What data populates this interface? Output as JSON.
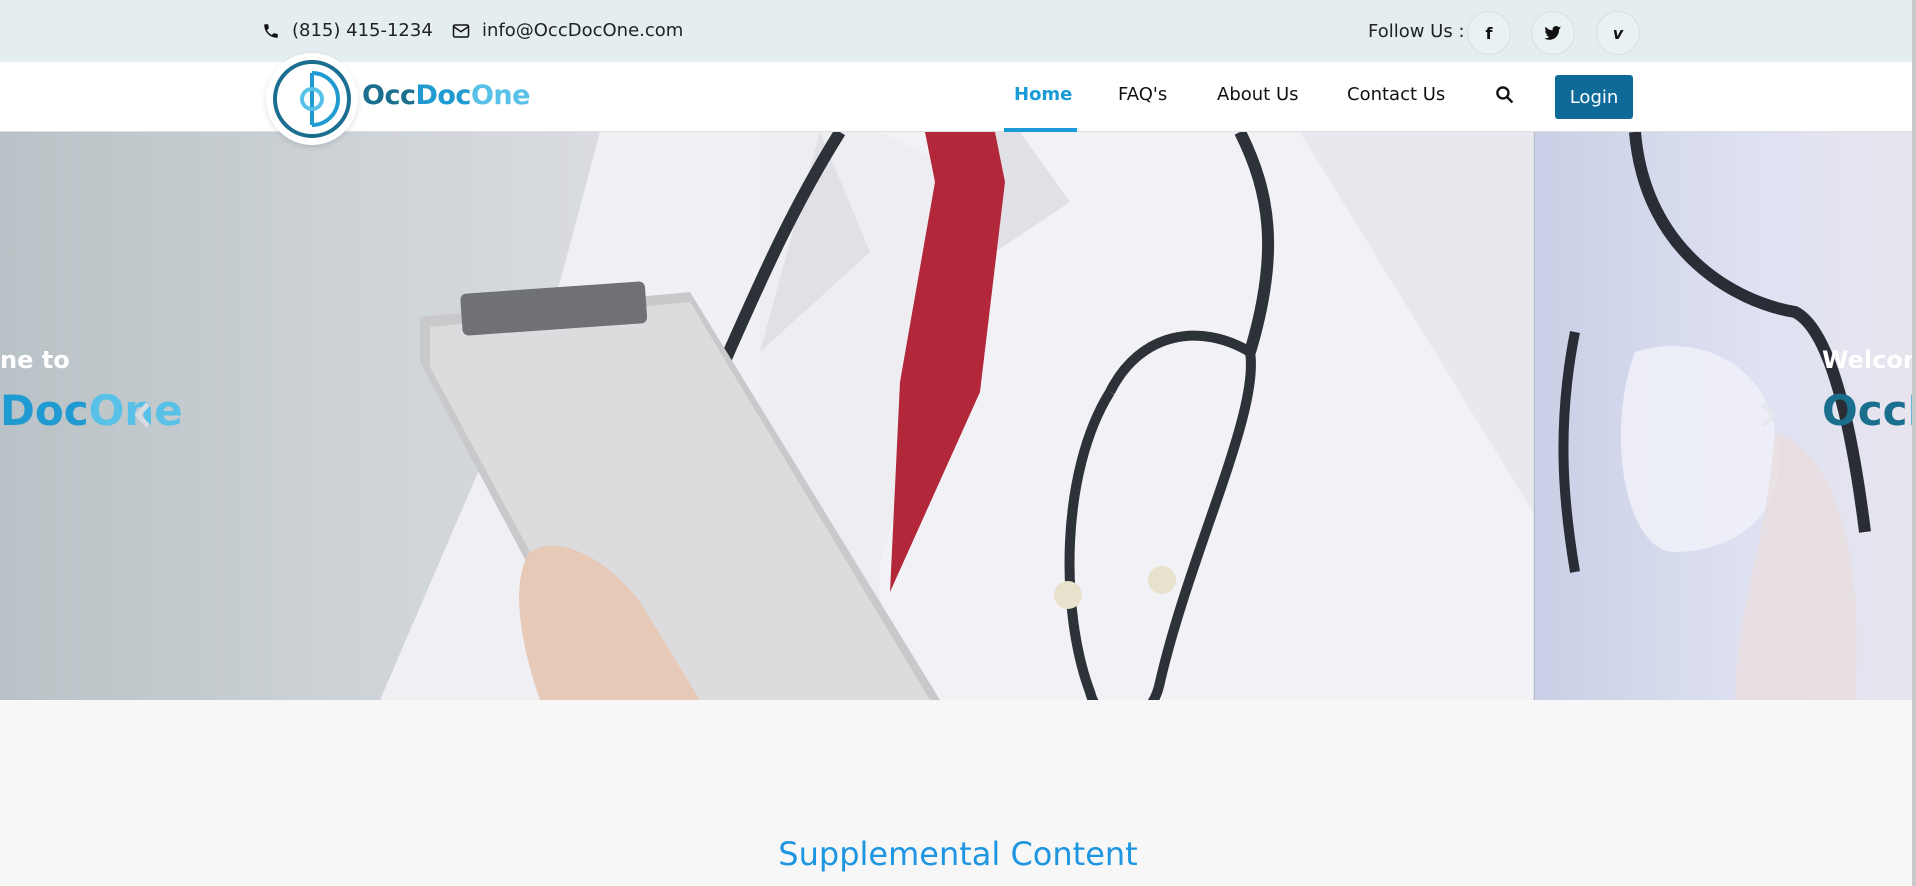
{
  "topbar": {
    "phone": "(815) 415-1234",
    "email": "info@OccDocOne.com",
    "follow_label": "Follow Us :",
    "social": [
      {
        "name": "facebook-icon",
        "glyph": "f"
      },
      {
        "name": "twitter-icon",
        "glyph": "t"
      },
      {
        "name": "vimeo-icon",
        "glyph": "v"
      }
    ]
  },
  "brand": {
    "occ": "Occ",
    "doc": "Doc",
    "one": "One"
  },
  "nav": {
    "home": "Home",
    "faq": "FAQ's",
    "about": "About Us",
    "contact": "Contact Us",
    "login": "Login"
  },
  "hero": {
    "slide_main": {
      "title_partial": "ne to",
      "brand_doc": "Doc",
      "brand_one": "One"
    },
    "slide_next": {
      "title_partial": "Welcon",
      "brand_partial_occ": "Occ",
      "brand_partial_d": "D"
    }
  },
  "supplemental": {
    "title": "Supplemental Content"
  },
  "colors": {
    "accent": "#1a9ad6",
    "login_bg": "#0e6a99",
    "brand_dark": "#1b6f8e",
    "brand_light": "#57c1e8"
  }
}
